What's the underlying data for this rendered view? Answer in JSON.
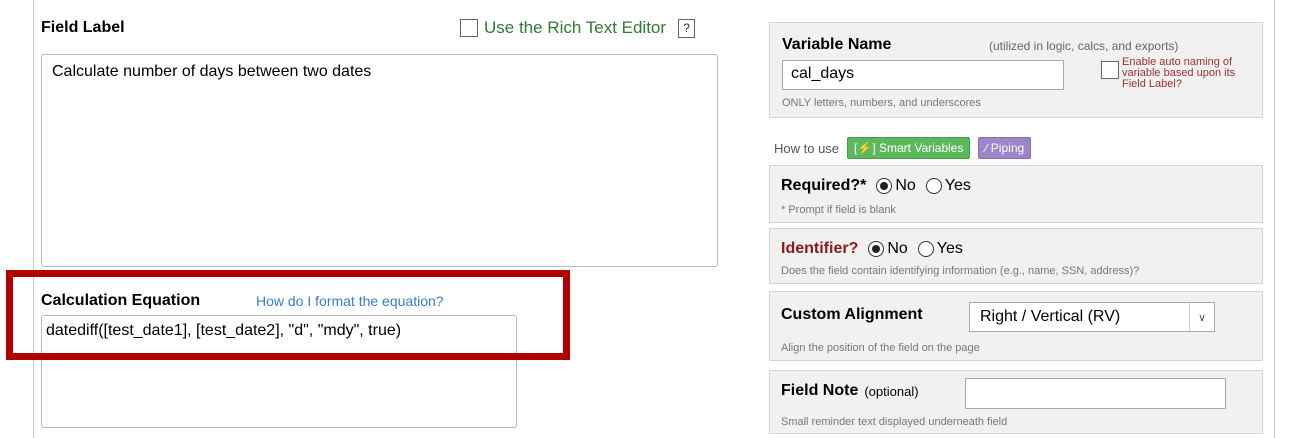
{
  "field_label": {
    "title": "Field Label",
    "rich_text_label": "Use the Rich Text Editor",
    "help_mark": "?",
    "value": "Calculate number of days between two dates"
  },
  "calculation": {
    "title": "Calculation Equation",
    "help_link": "How do I format the equation?",
    "value": "datediff([test_date1], [test_date2], \"d\", \"mdy\", true)"
  },
  "variable_name": {
    "title": "Variable Name",
    "note": "(utilized in logic, calcs, and exports)",
    "value": "cal_days",
    "hint": "ONLY letters, numbers, and underscores",
    "auto_naming_label": "Enable auto naming of variable based upon its Field Label?"
  },
  "how_to_use": {
    "label": "How to use",
    "smart_variables": "[⚡] Smart Variables",
    "piping": "∕ Piping"
  },
  "required": {
    "title": "Required?*",
    "options": [
      "No",
      "Yes"
    ],
    "selected": "No",
    "hint": "* Prompt if field is blank"
  },
  "identifier": {
    "title": "Identifier?",
    "options": [
      "No",
      "Yes"
    ],
    "selected": "No",
    "hint": "Does the field contain identifying information (e.g., name, SSN, address)?"
  },
  "custom_alignment": {
    "title": "Custom Alignment",
    "selected": "Right / Vertical (RV)",
    "hint": "Align the position of the field on the page"
  },
  "field_note": {
    "title": "Field Note",
    "optional": "(optional)",
    "value": "",
    "hint": "Small reminder text displayed underneath field"
  },
  "colors": {
    "highlight": "#b00000",
    "rich_text_label": "#2e7d32",
    "link": "#3a7bd5",
    "identifier": "#8b1a1a",
    "smart_variables_bg": "#5cb85c",
    "piping_bg": "#9b86c7"
  }
}
